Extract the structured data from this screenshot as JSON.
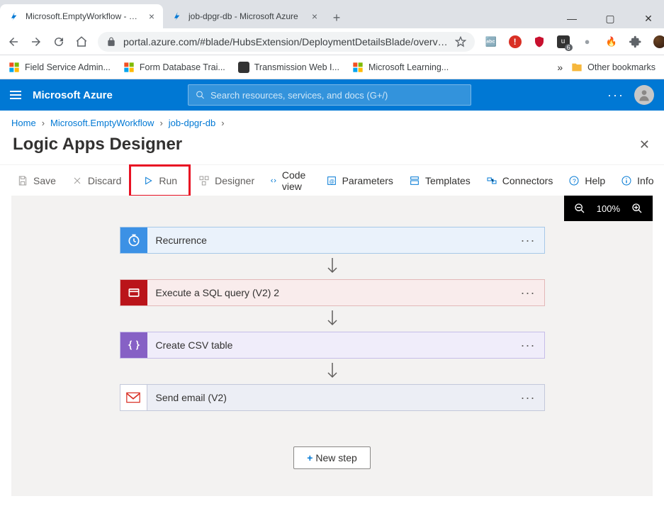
{
  "browser": {
    "tabs": [
      {
        "title": "Microsoft.EmptyWorkflow - Micr",
        "active": true
      },
      {
        "title": "job-dpgr-db - Microsoft Azure",
        "active": false
      }
    ],
    "url_display": "portal.azure.com/#blade/HubsExtension/DeploymentDetailsBlade/overv…",
    "bookmarks": [
      {
        "label": "Field Service Admin..."
      },
      {
        "label": "Form Database Trai..."
      },
      {
        "label": "Transmission Web I..."
      },
      {
        "label": "Microsoft Learning..."
      }
    ],
    "other_bookmarks_label": "Other bookmarks",
    "ext_badge": "6",
    "overflow_glyph": "»"
  },
  "azure": {
    "brand": "Microsoft Azure",
    "search_placeholder": "Search resources, services, and docs (G+/)",
    "breadcrumb": [
      {
        "label": "Home"
      },
      {
        "label": "Microsoft.EmptyWorkflow"
      },
      {
        "label": "job-dpgr-db"
      }
    ],
    "page_title": "Logic Apps Designer",
    "toolbar": {
      "save": "Save",
      "discard": "Discard",
      "run": "Run",
      "designer": "Designer",
      "codeview": "Code view",
      "parameters": "Parameters",
      "templates": "Templates",
      "connectors": "Connectors",
      "help": "Help",
      "info": "Info"
    },
    "zoom": "100%",
    "steps": [
      {
        "kind": "recurrence",
        "label": "Recurrence"
      },
      {
        "kind": "sql",
        "label": "Execute a SQL query (V2) 2"
      },
      {
        "kind": "csv",
        "label": "Create CSV table"
      },
      {
        "kind": "gmail",
        "label": "Send email (V2)"
      }
    ],
    "new_step": "New step"
  }
}
